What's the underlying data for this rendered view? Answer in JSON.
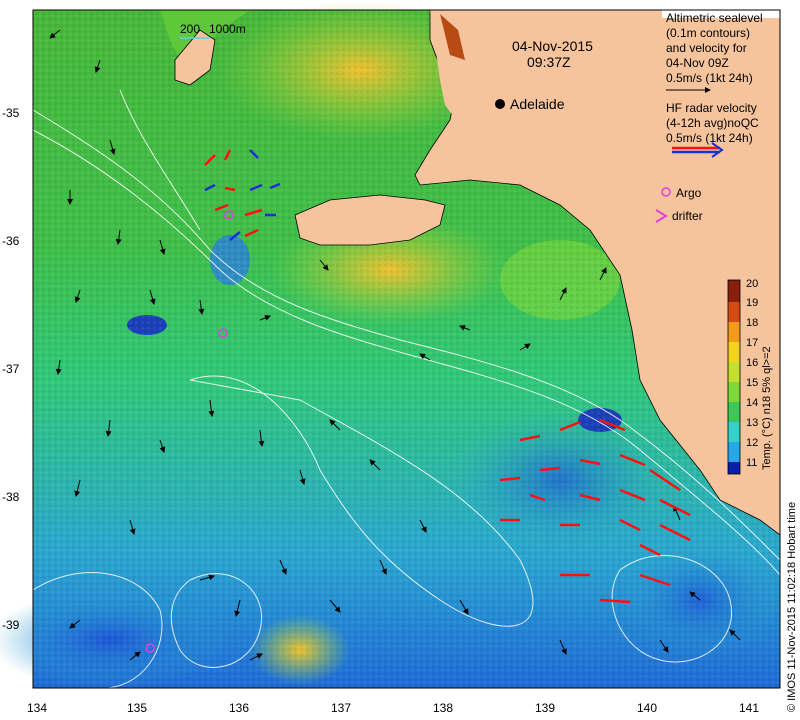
{
  "map": {
    "date": "04-Nov-2015",
    "time": "09:37Z",
    "city": "Adelaide",
    "scale_200": "200",
    "scale_1000": "1000m",
    "x_ticks": [
      "134",
      "135",
      "136",
      "137",
      "138",
      "139",
      "140",
      "141"
    ],
    "y_ticks": [
      "-35",
      "-36",
      "-37",
      "-38",
      "-39"
    ]
  },
  "legend": {
    "line1": "Altimetric sealevel",
    "line2": "(0.1m contours)",
    "line3": "and velocity for",
    "line4": "04-Nov 09Z",
    "line5": "0.5m/s (1kt 24h)",
    "hf1": "HF radar velocity",
    "hf2": "(4-12h avg)noQC",
    "hf3": "0.5m/s (1kt 24h)",
    "argo": "Argo",
    "drifter": "drifter"
  },
  "colorbar": {
    "label": "Temp. (°C) n18 5% ql>=2",
    "ticks": [
      "11",
      "12",
      "13",
      "14",
      "15",
      "16",
      "17",
      "18",
      "19",
      "20"
    ],
    "colors": [
      "#0a1fa6",
      "#1f5fe0",
      "#27a6e8",
      "#35d0c8",
      "#3fc65a",
      "#7fd83a",
      "#c4e02c",
      "#f2d21c",
      "#f39a17",
      "#d44a12",
      "#8a1f0c"
    ]
  },
  "credit": "© IMOS 11-Nov-2015 11:02:18 Hobart time",
  "colors": {
    "land": "#f6c49c",
    "ocean_mid": "#3fbf4a",
    "hf_arrow": "#ff1010",
    "argo": "#e040e0"
  }
}
